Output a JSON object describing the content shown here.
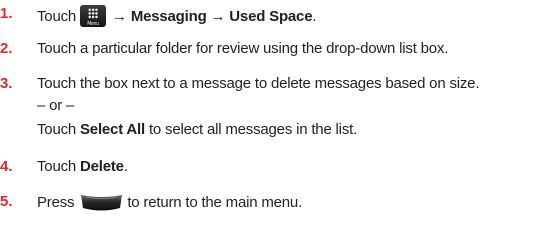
{
  "steps": [
    {
      "number": "1.",
      "lead": "Touch",
      "icon_menu": "menu-icon",
      "icon_menu_label": "Menu",
      "arrow1": "→",
      "item1": "Messaging",
      "arrow2": "→",
      "item2": "Used Space",
      "end": "."
    },
    {
      "number": "2.",
      "text": "Touch a particular folder for review using the drop-down list box."
    },
    {
      "number": "3.",
      "text": "Touch the box next to a message to delete messages based on size.",
      "or_text": "– or –",
      "alt_lead": "Touch ",
      "alt_bold": "Select All",
      "alt_rest": " to select all messages in the list."
    },
    {
      "number": "4.",
      "lead": "Touch ",
      "bold": "Delete",
      "end": "."
    },
    {
      "number": "5.",
      "lead": "Press",
      "icon_end": "end-key-icon",
      "rest": "to return to the main menu."
    }
  ]
}
